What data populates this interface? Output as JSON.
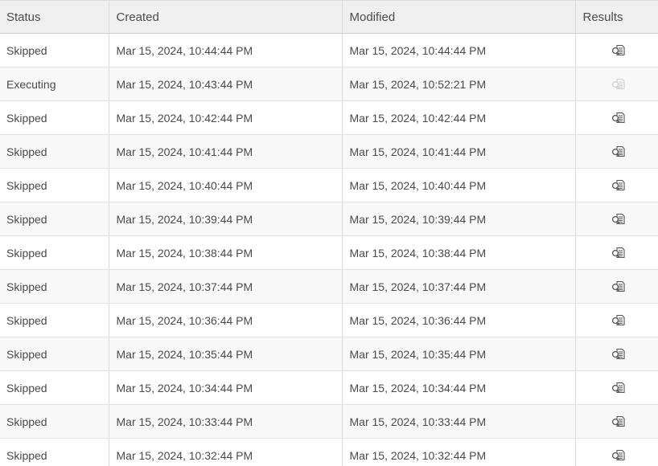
{
  "table": {
    "columns": {
      "status": "Status",
      "created": "Created",
      "modified": "Modified",
      "results": "Results"
    },
    "rows": [
      {
        "status": "Skipped",
        "created": "Mar 15, 2024, 10:44:44 PM",
        "modified": "Mar 15, 2024, 10:44:44 PM",
        "results_enabled": true
      },
      {
        "status": "Executing",
        "created": "Mar 15, 2024, 10:43:44 PM",
        "modified": "Mar 15, 2024, 10:52:21 PM",
        "results_enabled": false
      },
      {
        "status": "Skipped",
        "created": "Mar 15, 2024, 10:42:44 PM",
        "modified": "Mar 15, 2024, 10:42:44 PM",
        "results_enabled": true
      },
      {
        "status": "Skipped",
        "created": "Mar 15, 2024, 10:41:44 PM",
        "modified": "Mar 15, 2024, 10:41:44 PM",
        "results_enabled": true
      },
      {
        "status": "Skipped",
        "created": "Mar 15, 2024, 10:40:44 PM",
        "modified": "Mar 15, 2024, 10:40:44 PM",
        "results_enabled": true
      },
      {
        "status": "Skipped",
        "created": "Mar 15, 2024, 10:39:44 PM",
        "modified": "Mar 15, 2024, 10:39:44 PM",
        "results_enabled": true
      },
      {
        "status": "Skipped",
        "created": "Mar 15, 2024, 10:38:44 PM",
        "modified": "Mar 15, 2024, 10:38:44 PM",
        "results_enabled": true
      },
      {
        "status": "Skipped",
        "created": "Mar 15, 2024, 10:37:44 PM",
        "modified": "Mar 15, 2024, 10:37:44 PM",
        "results_enabled": true
      },
      {
        "status": "Skipped",
        "created": "Mar 15, 2024, 10:36:44 PM",
        "modified": "Mar 15, 2024, 10:36:44 PM",
        "results_enabled": true
      },
      {
        "status": "Skipped",
        "created": "Mar 15, 2024, 10:35:44 PM",
        "modified": "Mar 15, 2024, 10:35:44 PM",
        "results_enabled": true
      },
      {
        "status": "Skipped",
        "created": "Mar 15, 2024, 10:34:44 PM",
        "modified": "Mar 15, 2024, 10:34:44 PM",
        "results_enabled": true
      },
      {
        "status": "Skipped",
        "created": "Mar 15, 2024, 10:33:44 PM",
        "modified": "Mar 15, 2024, 10:33:44 PM",
        "results_enabled": true
      },
      {
        "status": "Skipped",
        "created": "Mar 15, 2024, 10:32:44 PM",
        "modified": "Mar 15, 2024, 10:32:44 PM",
        "results_enabled": true
      }
    ],
    "results_icon": "view-results-icon"
  }
}
